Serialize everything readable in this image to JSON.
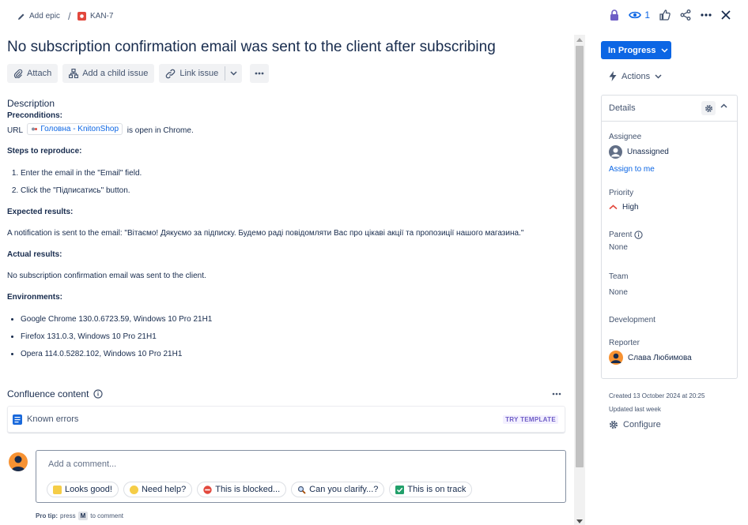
{
  "breadcrumb": {
    "add_epic": "Add epic",
    "separator": "/",
    "issue_key": "KAN-7"
  },
  "header_actions": {
    "watch_count": "1",
    "icons": [
      "lock-icon",
      "eye-icon",
      "thumbs-up-icon",
      "share-icon",
      "more-icon",
      "close-icon"
    ]
  },
  "issue": {
    "title": "No subscription confirmation email was sent to the client after subscribing"
  },
  "toolbar": {
    "attach": "Attach",
    "add_child": "Add a child issue",
    "link_issue": "Link issue"
  },
  "description": {
    "heading": "Description",
    "preconditions_label": "Preconditions:",
    "url_prefix": "URL",
    "url_chip": "Головна - KnitonShop",
    "url_suffix": "is open in Chrome.",
    "steps_label": "Steps to reproduce:",
    "steps": [
      "Enter the email in the \"Email\" field.",
      "Click the \"Підписатись\" button."
    ],
    "expected_label": "Expected results:",
    "expected_text": "A notification is sent to the email: \"Вітаємо! Дякуємо за підписку. Будемо раді повідомляти Вас про цікаві акції та пропозиції нашого магазина.\"",
    "actual_label": "Actual results:",
    "actual_text": "No subscription confirmation email was sent to the client.",
    "env_label": "Environments:",
    "environments": [
      "Google Chrome 130.0.6723.59, Windows 10 Pro 21H1",
      "Firefox 131.0.3, Windows 10 Pro 21H1",
      "Opera 114.0.5282.102, Windows 10 Pro 21H1"
    ]
  },
  "confluence": {
    "heading": "Confluence content",
    "card_title": "Known errors",
    "try_label": "TRY TEMPLATE"
  },
  "comment": {
    "placeholder": "Add a comment...",
    "suggestions": [
      "Looks good!",
      "Need help?",
      "This is blocked...",
      "Can you clarify...?",
      "This is on track"
    ],
    "protip_prefix": "Pro tip:",
    "protip_press": "press",
    "protip_key": "M",
    "protip_suffix": "to comment"
  },
  "sidebar": {
    "status": "In Progress",
    "actions": "Actions",
    "details_title": "Details",
    "assignee_label": "Assignee",
    "assignee_value": "Unassigned",
    "assign_to_me": "Assign to me",
    "priority_label": "Priority",
    "priority_value": "High",
    "parent_label": "Parent",
    "parent_value": "None",
    "team_label": "Team",
    "team_value": "None",
    "development_label": "Development",
    "reporter_label": "Reporter",
    "reporter_value": "Слава Любимова",
    "created": "Created 13 October 2024 at 20:25",
    "updated": "Updated last week",
    "configure": "Configure"
  },
  "colors": {
    "primary": "#0c66e4",
    "priority_high": "#e2483d",
    "issue_type_bug": "#e2483d",
    "avatar": "#f79232"
  }
}
